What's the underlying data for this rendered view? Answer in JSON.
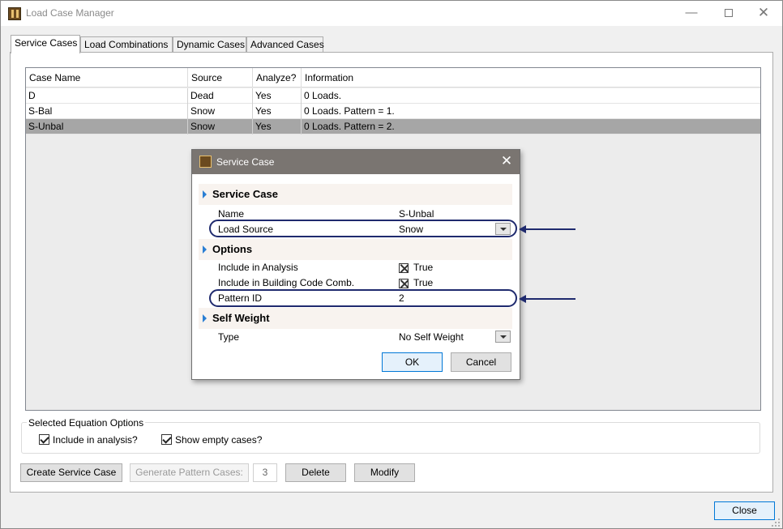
{
  "window": {
    "title": "Load Case Manager",
    "minimize_glyph": "—",
    "close_glyph": "✕"
  },
  "tabs": [
    "Service Cases",
    "Load Combinations",
    "Dynamic Cases",
    "Advanced Cases"
  ],
  "grid": {
    "columns": [
      "Case Name",
      "Source",
      "Analyze?",
      "Information"
    ],
    "rows": [
      {
        "name": "D",
        "source": "Dead",
        "analyze": "Yes",
        "info": "0 Loads."
      },
      {
        "name": "S-Bal",
        "source": "Snow",
        "analyze": "Yes",
        "info": "0 Loads. Pattern = 1."
      },
      {
        "name": "S-Unbal",
        "source": "Snow",
        "analyze": "Yes",
        "info": "0 Loads. Pattern = 2."
      }
    ],
    "selected_row": 2
  },
  "equation_options": {
    "legend": "Selected Equation Options",
    "include_in_analysis": "Include in analysis?",
    "show_empty_cases": "Show empty cases?"
  },
  "buttons": {
    "create": "Create Service Case",
    "generate": "Generate Pattern Cases:",
    "pattern_count": "3",
    "delete": "Delete",
    "modify": "Modify",
    "close": "Close"
  },
  "dialog": {
    "title": "Service Case",
    "close_glyph": "✕",
    "sections": {
      "service_case": "Service Case",
      "options": "Options",
      "self_weight": "Self Weight"
    },
    "props": {
      "name_label": "Name",
      "name_value": "S-Unbal",
      "load_source_label": "Load Source",
      "load_source_value": "Snow",
      "include_analysis_label": "Include in Analysis",
      "include_analysis_value": "True",
      "include_code_label": "Include in Building Code Comb.",
      "include_code_value": "True",
      "pattern_id_label": "Pattern ID",
      "pattern_id_value": "2",
      "type_label": "Type",
      "type_value": "No Self Weight"
    },
    "ok": "OK",
    "cancel": "Cancel"
  },
  "colors": {
    "dialog_titlebar": "#7a7571",
    "selected_row": "#a6a6a6",
    "highlight": "#1f2a6e",
    "section_arrow": "#2a7fd4"
  }
}
